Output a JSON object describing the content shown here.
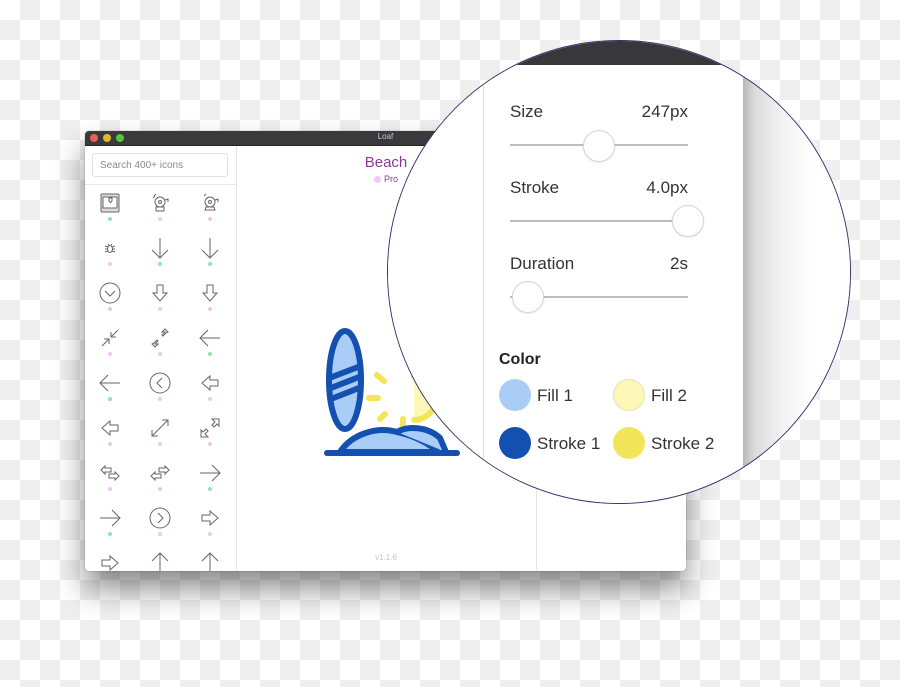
{
  "window": {
    "title": "Loaf",
    "traffic_lights": [
      "close",
      "minimize",
      "maximize"
    ]
  },
  "sidebar": {
    "search_placeholder": "Search 400+ icons",
    "icons": [
      {
        "name": "3d-printer-icon",
        "tier": "free"
      },
      {
        "name": "alarm-bell-ringing-icon",
        "tier": "pro"
      },
      {
        "name": "alarm-bell-icon",
        "tier": "pro"
      },
      {
        "name": "bug-icon",
        "tier": "pro"
      },
      {
        "name": "arrow-down-thin-icon",
        "tier": "free"
      },
      {
        "name": "arrow-down-thin-alt-icon",
        "tier": "free"
      },
      {
        "name": "arrow-down-circle-icon",
        "tier": "pro"
      },
      {
        "name": "arrow-down-outline-icon",
        "tier": "pro"
      },
      {
        "name": "arrow-down-outline-alt-icon",
        "tier": "pro"
      },
      {
        "name": "arrows-collapse-icon",
        "tier": "pro"
      },
      {
        "name": "arrows-collapse-outline-icon",
        "tier": "pro"
      },
      {
        "name": "arrow-left-thin-icon",
        "tier": "free"
      },
      {
        "name": "arrow-left-thin-alt-icon",
        "tier": "free"
      },
      {
        "name": "arrow-left-circle-icon",
        "tier": "pro"
      },
      {
        "name": "arrow-left-outline-icon",
        "tier": "pro"
      },
      {
        "name": "arrow-left-outline-alt-icon",
        "tier": "pro"
      },
      {
        "name": "arrows-expand-icon",
        "tier": "pro"
      },
      {
        "name": "arrows-expand-outline-icon",
        "tier": "pro"
      },
      {
        "name": "arrows-swap-icon",
        "tier": "pro"
      },
      {
        "name": "arrows-swap-alt-icon",
        "tier": "pro"
      },
      {
        "name": "arrow-right-thin-icon",
        "tier": "free"
      },
      {
        "name": "arrow-right-thin-alt-icon",
        "tier": "free"
      },
      {
        "name": "arrow-right-circle-icon",
        "tier": "pro"
      },
      {
        "name": "arrow-right-outline-icon",
        "tier": "pro"
      },
      {
        "name": "arrow-right-outline-alt-icon",
        "tier": "pro"
      },
      {
        "name": "arrow-up-thin-icon",
        "tier": "free"
      },
      {
        "name": "arrow-up-thin-alt-icon",
        "tier": "free"
      }
    ]
  },
  "preview": {
    "icon_name": "Beach",
    "badge": "Pro",
    "version": "v1.1.6",
    "icon_semantic": "beach-icon"
  },
  "settings": {
    "sliders": [
      {
        "label": "Size",
        "value": "247px",
        "fraction": 0.5
      },
      {
        "label": "Stroke",
        "value": "4.0px",
        "fraction": 1.0
      },
      {
        "label": "Duration",
        "value": "2s",
        "fraction": 0.1
      }
    ],
    "color_heading": "Color",
    "colors": [
      {
        "label": "Fill 1",
        "hex": "#a9cdf7"
      },
      {
        "label": "Fill 2",
        "hex": "#fdf8b8"
      },
      {
        "label": "Stroke 1",
        "hex": "#1450b0"
      },
      {
        "label": "Stroke 2",
        "hex": "#f2e55a"
      }
    ]
  },
  "colors": {
    "accent_purple": "#8a3a96",
    "free_dot": "#8ee8a8",
    "pro_dot": "#f0c4f4",
    "magnifier_border": "#3b2f6e"
  }
}
